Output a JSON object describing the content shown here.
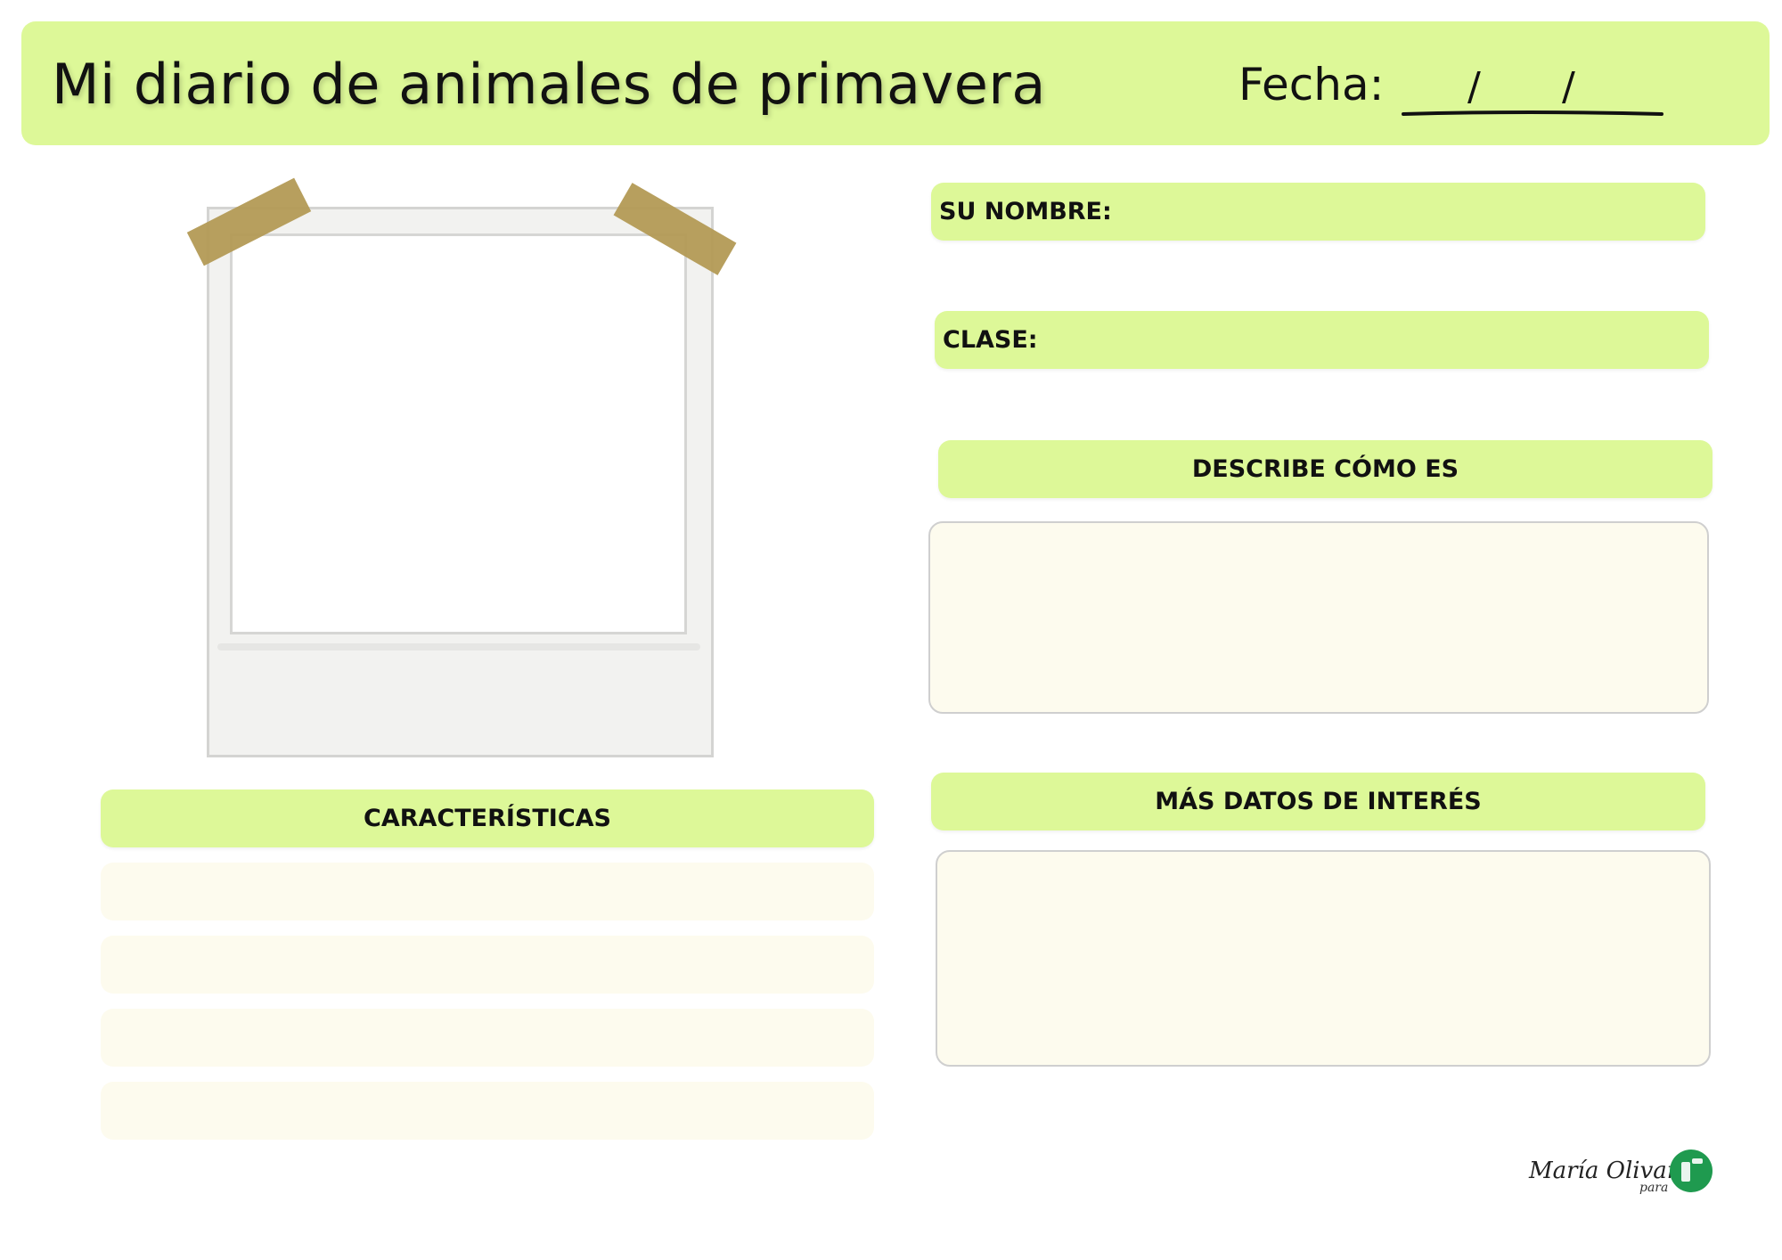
{
  "header": {
    "title": "Mi diario de animales de primavera",
    "date_label": "Fecha:",
    "date_separator_1": "/",
    "date_separator_2": "/"
  },
  "fields": {
    "nombre_label": "SU NOMBRE:",
    "clase_label": "CLASE:"
  },
  "sections": {
    "describe_title": "DESCRIBE CÓMO ES",
    "datos_title": "MÁS DATOS DE INTERÉS",
    "caracteristicas_title": "CARACTERÍSTICAS"
  },
  "footer": {
    "signature": "María Olivares",
    "signature_para": "para"
  },
  "colors": {
    "accent_green": "#ddf898",
    "write_area": "#fdfbee",
    "tape": "#b39a55",
    "logo_green": "#1f9a4f"
  },
  "icons": {
    "logo": "publisher-logo-icon"
  }
}
